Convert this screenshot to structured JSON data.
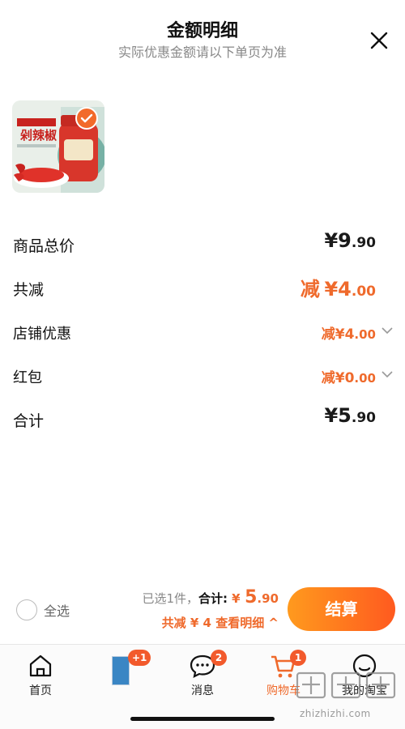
{
  "header": {
    "title": "金额明细",
    "subtitle": "实际优惠金额请以下单页为准",
    "close_icon": "close-icon"
  },
  "product": {
    "image_icon": "chili-sauce-jar-photo",
    "brand_text": "剁辣椒",
    "selected": true
  },
  "breakdown": {
    "total": {
      "label": "商品总价",
      "currency": "¥",
      "amount_main": "9",
      "amount_dec": ".90"
    },
    "discount": {
      "label": "共减",
      "prefix": "减",
      "currency": "¥",
      "amount_main": "4",
      "amount_dec": ".00"
    },
    "shop_coupon": {
      "label": "店铺优惠",
      "prefix": "减",
      "currency": "¥",
      "amount_main": "4",
      "amount_dec": ".00"
    },
    "red_packet": {
      "label": "红包",
      "prefix": "减",
      "currency": "¥",
      "amount_main": "0",
      "amount_dec": ".00"
    },
    "sum": {
      "label": "合计",
      "currency": "¥",
      "amount_main": "5",
      "amount_dec": ".90"
    }
  },
  "checkout": {
    "select_all_label": "全选",
    "selected_count_text": "已选1件，",
    "sum_label": "合计:",
    "currency": "¥",
    "sum_main": "5",
    "sum_dec": ".90",
    "discount_text": "共减 ¥ 4  查看明细 ^",
    "button_label": "结算"
  },
  "tabbar": {
    "home": {
      "label": "首页",
      "icon": "home-icon"
    },
    "promo": {
      "badge": "+1",
      "icon": "promo-item-thumbnail"
    },
    "messages": {
      "label": "消息",
      "badge": "2",
      "icon": "chat-bubble-icon"
    },
    "cart": {
      "label": "购物车",
      "badge": "1",
      "icon": "shopping-cart-icon"
    },
    "me": {
      "label": "我的淘宝",
      "icon": "profile-face-icon"
    }
  },
  "watermark": {
    "logo_text": "值",
    "url": "zhizhizhi.com"
  },
  "colors": {
    "accent": "#ef6a2c",
    "button_gradient_start": "#ff9a1e",
    "button_gradient_end": "#ff5a1f",
    "text_primary": "#111111",
    "text_secondary": "#888888"
  }
}
